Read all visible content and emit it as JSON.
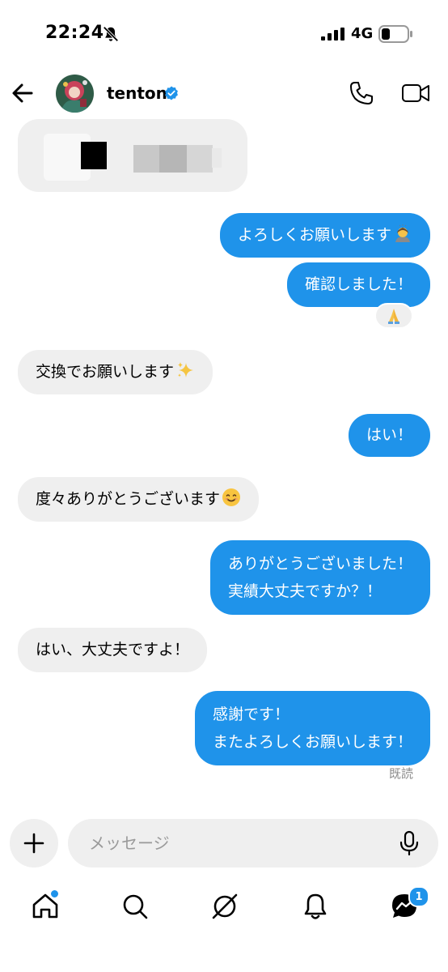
{
  "status_bar": {
    "time": "22:24",
    "network": "4G"
  },
  "header": {
    "name": "tenton",
    "verified": true
  },
  "messages": [
    {
      "side": "outgoing",
      "text": "よろしくお願いします",
      "emoji": "person-bowing-emoji"
    },
    {
      "side": "outgoing",
      "text": "確認しました！",
      "reaction": "folded-hands-emoji"
    },
    {
      "side": "incoming",
      "text": "交換でお願いします",
      "emoji": "sparkles-emoji"
    },
    {
      "side": "outgoing",
      "text": "はい！"
    },
    {
      "side": "incoming",
      "text": "度々ありがとうございます",
      "emoji": "smiling-face-emoji"
    },
    {
      "side": "outgoing",
      "lines": [
        "ありがとうございました！",
        "実績大丈夫ですか？！"
      ]
    },
    {
      "side": "incoming",
      "text": "はい、大丈夫ですよ！"
    },
    {
      "side": "outgoing",
      "lines": [
        "感謝です！",
        "またよろしくお願いします！"
      ]
    }
  ],
  "read_receipt": "既読",
  "composer": {
    "placeholder": "メッセージ"
  },
  "bottom_nav": {
    "items": [
      "home-icon",
      "search-icon",
      "explore-icon",
      "notifications-icon",
      "messages-icon"
    ],
    "messages_badge": "1"
  },
  "colors": {
    "outgoing_bubble": "#1f93ea",
    "incoming_bubble": "#efefef",
    "accent": "#1f93ea"
  }
}
